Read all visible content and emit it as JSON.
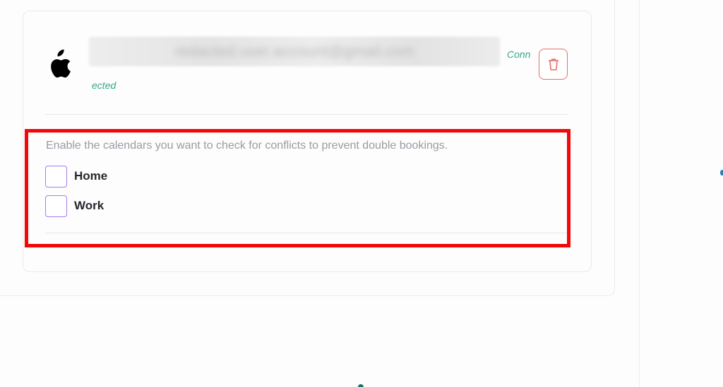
{
  "account": {
    "provider_icon": "apple-icon",
    "email_redacted": "redacted.user.account@gmail.com",
    "status_part_1": "Conn",
    "status_part_2": "ected",
    "delete_icon": "trash-icon"
  },
  "calendars": {
    "help_text": "Enable the calendars you want to check for conflicts to prevent double bookings.",
    "items": [
      {
        "label": "Home",
        "checked": false
      },
      {
        "label": "Work",
        "checked": false
      }
    ]
  },
  "colors": {
    "status_green": "#34a98a",
    "delete_red": "#ea6b6b",
    "checkbox_purple": "#a37cf0",
    "highlight_red": "#f20808"
  }
}
